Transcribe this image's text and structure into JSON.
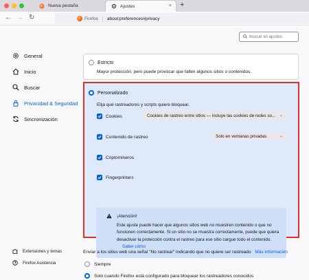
{
  "browser": {
    "traffic_lights": [
      "#ff5f57",
      "#febc2e",
      "#28c840"
    ],
    "tabs": [
      {
        "label": "Nueva pestaña",
        "active": false
      },
      {
        "label": "Ajustes",
        "active": true
      }
    ],
    "new_tab_label": "+",
    "tab_close_label": "×",
    "url_brand": "Firefox",
    "url": "about:preferences#privacy",
    "back_label": "←",
    "forward_label": "→",
    "reload_label": "↻"
  },
  "search": {
    "placeholder": "Buscar en ajustes"
  },
  "sidebar": {
    "items": [
      {
        "label": "General",
        "icon": "gear-icon"
      },
      {
        "label": "Inicio",
        "icon": "home-icon"
      },
      {
        "label": "Buscar",
        "icon": "search-icon"
      },
      {
        "label": "Privacidad & Seguridad",
        "icon": "lock-icon",
        "selected": true
      },
      {
        "label": "Sincronización",
        "icon": "sync-icon"
      }
    ],
    "bottom": [
      {
        "label": "Extensiones y temas",
        "icon": "puzzle-icon"
      },
      {
        "label": "Firefox Asistencia",
        "icon": "help-icon"
      }
    ]
  },
  "strict": {
    "title": "Estricto",
    "description": "Mayor protección, pero puede provocar que fallen algunos sitios o contenidos."
  },
  "custom": {
    "title": "Personalizado",
    "description": "Elija qué rastreadores y scripts quiere bloquear.",
    "options": [
      {
        "label": "Cookies",
        "checked": true,
        "select": "Cookies de rastreo entre sitios — incluye las cookies de redes so..."
      },
      {
        "label": "Contenido de rastreo",
        "checked": true,
        "select": "Solo en ventanas privadas"
      },
      {
        "label": "Criptomineros",
        "checked": true
      },
      {
        "label": "Fingerprinters",
        "checked": true
      }
    ],
    "warning": {
      "title": "¡Atención!",
      "body": "Este ajuste puede hacer que algunos sitios web no muestren contenido o que no funcionen correctamente. Si un sitio no se muestra correctamente, puede que quiera desactivar la protección contra el rastreo para ese sitio cargue todo el contenido.",
      "link": "Saber cómo"
    }
  },
  "dnt": {
    "text": "Enviar a los sitios web una señal \"No rastrear\" indicando que no quiere ser rastreado",
    "link": "Más información",
    "options": [
      {
        "label": "Siempre",
        "checked": false
      },
      {
        "label": "Solo cuando Firefox está configurado para bloquear los rastreadores conocidos",
        "checked": true
      }
    ]
  },
  "colors": {
    "accent": "#0061e0",
    "highlight_border": "#e22e24",
    "custom_bg": "#deeafb"
  }
}
